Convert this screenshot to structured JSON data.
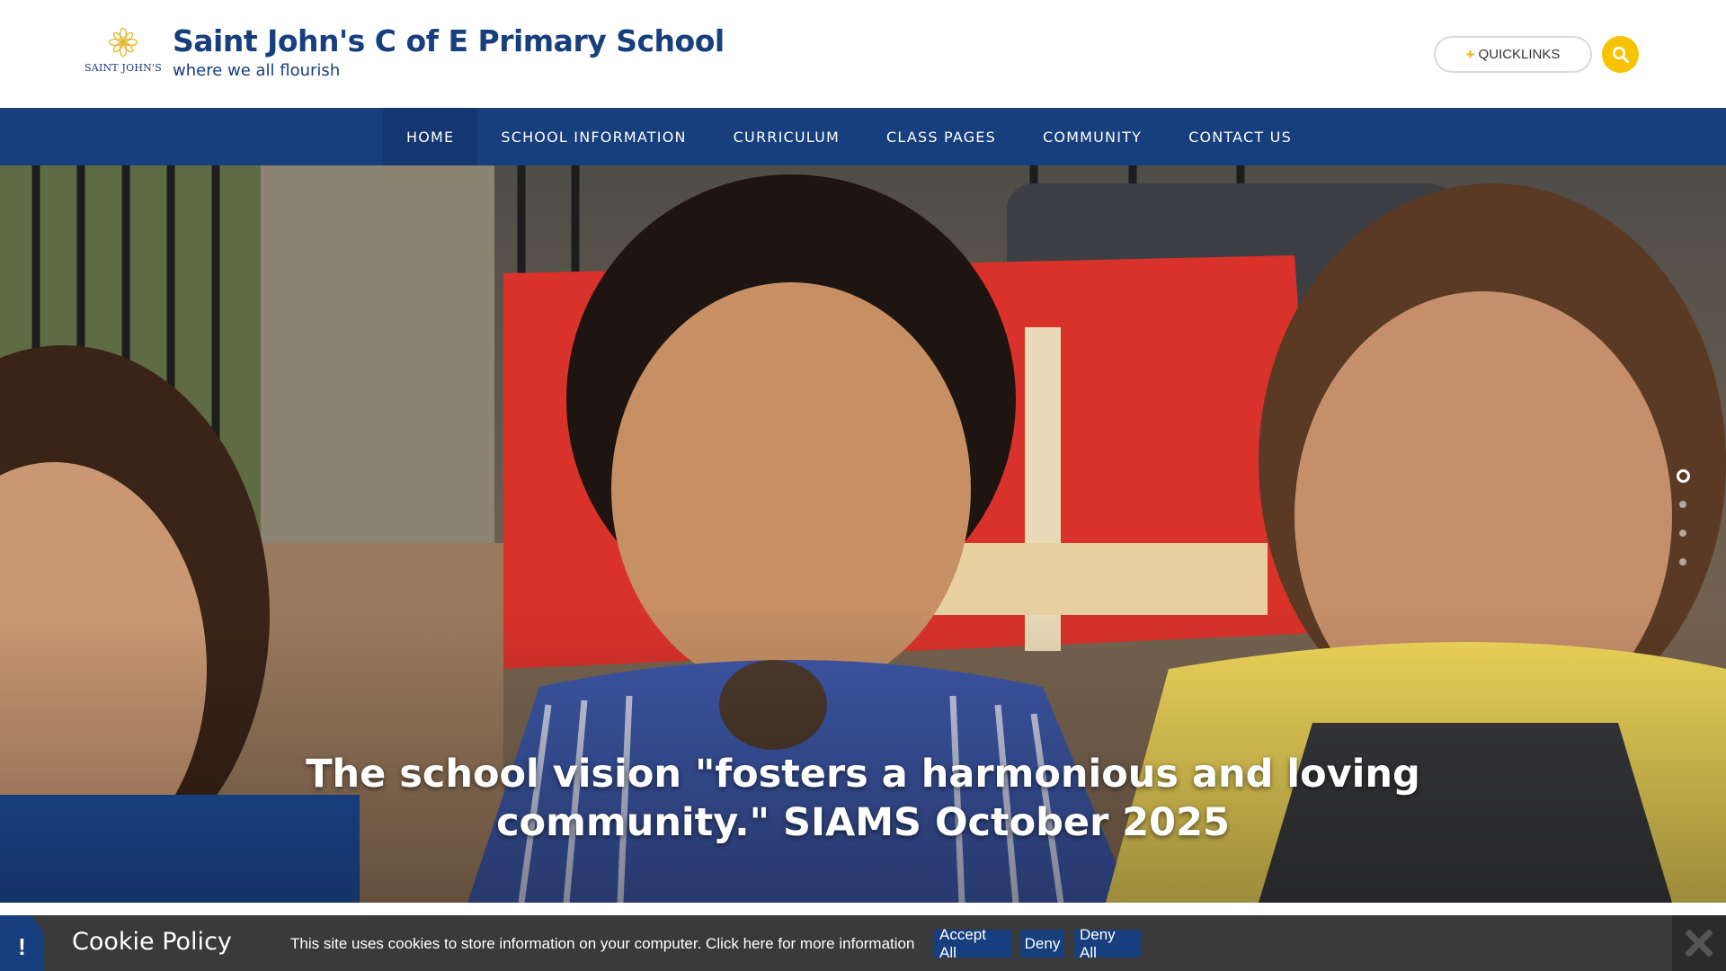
{
  "header": {
    "logo_text": "SAINT JOHN'S",
    "title": "Saint John's C of E Primary School",
    "tagline": "where we all flourish",
    "quicklinks_plus": "+",
    "quicklinks_label": "QUICKLINKS",
    "search_icon": "search-icon"
  },
  "nav": {
    "items": [
      {
        "label": "HOME"
      },
      {
        "label": "SCHOOL INFORMATION"
      },
      {
        "label": "CURRICULUM"
      },
      {
        "label": "CLASS PAGES"
      },
      {
        "label": "COMMUNITY"
      },
      {
        "label": "CONTACT US"
      }
    ]
  },
  "hero": {
    "caption": "The school vision \"fosters a harmonious and loving community.\" SIAMS October 2025",
    "slide_count": 4,
    "active_slide": 1
  },
  "cookie": {
    "alert_glyph": "!",
    "title": "Cookie Policy",
    "text": "This site uses cookies to store information on your computer. Click here for more information",
    "accept_all": "Accept All",
    "deny": "Deny",
    "deny_all": "Deny All",
    "close_icon": "close-icon"
  },
  "colors": {
    "brand_blue": "#173e7d",
    "accent_yellow": "#f7c300",
    "cookie_bar": "#3a3a3a"
  }
}
